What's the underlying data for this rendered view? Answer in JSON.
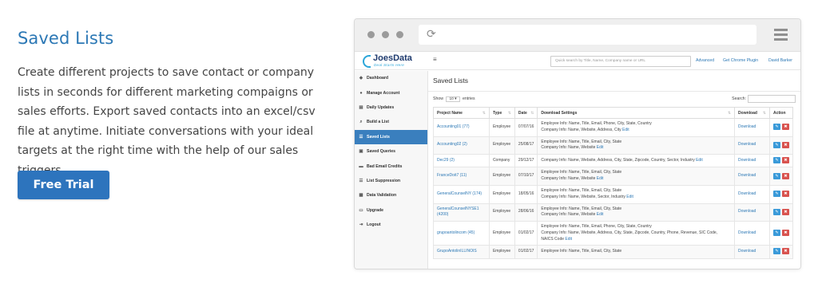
{
  "hero": {
    "title": "Saved Lists",
    "description": "Create different projects to save contact or company lists in seconds for different marketing compaigns or sales efforts. Export saved contacts into an excel/csv file at anytime. Initiate conversations with your ideal targets at the right time with the help of our sales triggers.",
    "cta_label": "Free Trial"
  },
  "browser": {
    "reload_glyph": "⟳"
  },
  "app": {
    "logo_name": "JoesData",
    "logo_tagline": "Deal Starts Here",
    "menu_glyph": "≡",
    "search_placeholder": "Quick search by Title, Name, Company name or URL",
    "links": {
      "advanced": "Advanced",
      "chrome_plugin": "Get Chrome Plugin",
      "user": "David Barker"
    }
  },
  "sidebar": {
    "items": [
      {
        "label": "Dashboard",
        "icon": "dashboard-icon",
        "glyph": "◈"
      },
      {
        "label": "Manage Account",
        "icon": "user-icon",
        "glyph": "●"
      },
      {
        "label": "Daily Updates",
        "icon": "chart-icon",
        "glyph": "▤"
      },
      {
        "label": "Build a List",
        "icon": "search-icon",
        "glyph": "⌕"
      },
      {
        "label": "Saved Lists",
        "icon": "list-icon",
        "glyph": "☰",
        "active": true
      },
      {
        "label": "Saved Queries",
        "icon": "save-icon",
        "glyph": "▣"
      },
      {
        "label": "Bad Email Credits",
        "icon": "credit-card-icon",
        "glyph": "▬"
      },
      {
        "label": "List Suppression",
        "icon": "list-icon",
        "glyph": "☰"
      },
      {
        "label": "Data Validation",
        "icon": "check-icon",
        "glyph": "▦"
      },
      {
        "label": "Upgrade",
        "icon": "upgrade-icon",
        "glyph": "▭"
      },
      {
        "label": "Logout",
        "icon": "logout-icon",
        "glyph": "⇥"
      }
    ]
  },
  "main": {
    "heading": "Saved Lists",
    "show_label": "Show",
    "entries_value": "10",
    "entries_label": "entries",
    "search_label": "Search:",
    "columns": [
      "Project Name",
      "Type",
      "Date",
      "Download Settings",
      "Download",
      "Action"
    ],
    "rows": [
      {
        "name": "Accounting01 (77)",
        "type": "Employee",
        "date": "07/07/16",
        "settings": [
          "Employee Info: Name, Title, Email, Phone, City, State, Country",
          "Company Info: Name, Website, Address, City"
        ],
        "download": "Download"
      },
      {
        "name": "Accounting02 (2)",
        "type": "Employee",
        "date": "25/08/17",
        "settings": [
          "Employee Info: Name, Title, Email, City, State",
          "Company Info: Name, Website"
        ],
        "download": "Download"
      },
      {
        "name": "Dec29 (2)",
        "type": "Company",
        "date": "29/12/17",
        "settings": [
          "Company Info: Name, Website, Address, City, State, Zipcode, Country, Sector, Industry"
        ],
        "download": "Download"
      },
      {
        "name": "FranceDoit7 (11)",
        "type": "Employee",
        "date": "07/10/17",
        "settings": [
          "Employee Info: Name, Title, Email, City, State",
          "Company Info: Name, Website"
        ],
        "download": "Download"
      },
      {
        "name": "GeneralCounselNY (174)",
        "type": "Employee",
        "date": "18/05/16",
        "settings": [
          "Employee Info: Name, Title, Email, City, State",
          "Company Info: Name, Website, Sector, Industry"
        ],
        "download": "Download"
      },
      {
        "name": "GeneralCounselNYSE1 (4200)",
        "type": "Employee",
        "date": "28/06/16",
        "settings": [
          "Employee Info: Name, Title, Email, City, State",
          "Company Info: Name, Website"
        ],
        "download": "Download"
      },
      {
        "name": "grupoantolincom (45)",
        "type": "Employee",
        "date": "01/02/17",
        "settings": [
          "Employee Info: Name, Title, Email, Phone, City, State, Country",
          "Company Info: Name, Website, Address, City, State, Zipcode, Country, Phone, Revenue, SIC Code,",
          "NAICS Code"
        ],
        "download": "Download"
      },
      {
        "name": "GrupoAntolinILLINOIS",
        "type": "Employee",
        "date": "01/02/17",
        "settings": [
          "Employee Info: Name, Title, Email, City, State"
        ],
        "download": "Download"
      }
    ],
    "edit_label": "Edit",
    "edit_glyph": "✎",
    "delete_glyph": "✖"
  }
}
